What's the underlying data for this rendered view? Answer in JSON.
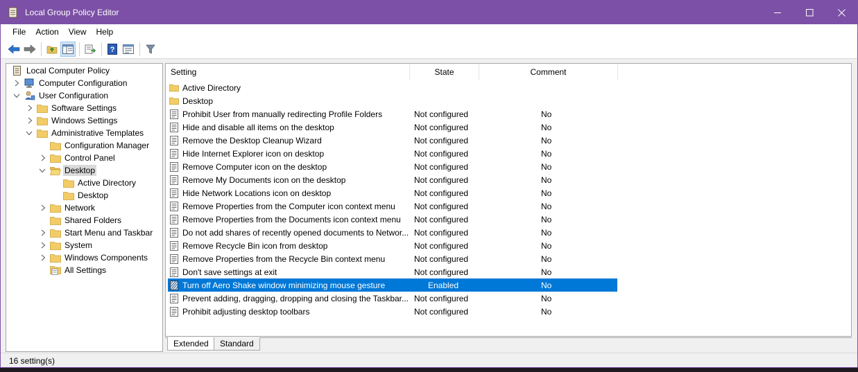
{
  "window": {
    "title": "Local Group Policy Editor",
    "accent_color": "#7c50a6",
    "selection_color": "#0078d7"
  },
  "menu": [
    "File",
    "Action",
    "View",
    "Help"
  ],
  "toolbar": {
    "icons": [
      "back-icon",
      "forward-icon",
      "up-folder-icon",
      "show-hide-tree-icon",
      "export-list-icon",
      "help-icon",
      "extended-view-icon",
      "filter-icon"
    ]
  },
  "tree": {
    "root": "Local Computer Policy",
    "computer_config": "Computer Configuration",
    "user_config": "User Configuration",
    "software_settings": "Software Settings",
    "windows_settings": "Windows Settings",
    "admin_templates": "Administrative Templates",
    "config_manager": "Configuration Manager",
    "control_panel": "Control Panel",
    "desktop": "Desktop",
    "active_directory": "Active Directory",
    "desktop_sub": "Desktop",
    "network": "Network",
    "shared_folders": "Shared Folders",
    "start_menu": "Start Menu and Taskbar",
    "system": "System",
    "windows_components": "Windows Components",
    "all_settings": "All Settings"
  },
  "list": {
    "columns": {
      "setting": "Setting",
      "state": "State",
      "comment": "Comment"
    },
    "folders": [
      "Active Directory",
      "Desktop"
    ],
    "rows": [
      {
        "name": "Prohibit User from manually redirecting Profile Folders",
        "state": "Not configured",
        "comment": "No"
      },
      {
        "name": "Hide and disable all items on the desktop",
        "state": "Not configured",
        "comment": "No"
      },
      {
        "name": "Remove the Desktop Cleanup Wizard",
        "state": "Not configured",
        "comment": "No"
      },
      {
        "name": "Hide Internet Explorer icon on desktop",
        "state": "Not configured",
        "comment": "No"
      },
      {
        "name": "Remove Computer icon on the desktop",
        "state": "Not configured",
        "comment": "No"
      },
      {
        "name": "Remove My Documents icon on the desktop",
        "state": "Not configured",
        "comment": "No"
      },
      {
        "name": "Hide Network Locations icon on desktop",
        "state": "Not configured",
        "comment": "No"
      },
      {
        "name": "Remove Properties from the Computer icon context menu",
        "state": "Not configured",
        "comment": "No"
      },
      {
        "name": "Remove Properties from the Documents icon context menu",
        "state": "Not configured",
        "comment": "No"
      },
      {
        "name": "Do not add shares of recently opened documents to Networ...",
        "state": "Not configured",
        "comment": "No"
      },
      {
        "name": "Remove Recycle Bin icon from desktop",
        "state": "Not configured",
        "comment": "No"
      },
      {
        "name": "Remove Properties from the Recycle Bin context menu",
        "state": "Not configured",
        "comment": "No"
      },
      {
        "name": "Don't save settings at exit",
        "state": "Not configured",
        "comment": "No"
      },
      {
        "name": "Turn off Aero Shake window minimizing mouse gesture",
        "state": "Enabled",
        "comment": "No",
        "selected": true
      },
      {
        "name": "Prevent adding, dragging, dropping and closing the Taskbar...",
        "state": "Not configured",
        "comment": "No"
      },
      {
        "name": "Prohibit adjusting desktop toolbars",
        "state": "Not configured",
        "comment": "No"
      }
    ]
  },
  "tabs": [
    "Extended",
    "Standard"
  ],
  "status": "16 setting(s)"
}
